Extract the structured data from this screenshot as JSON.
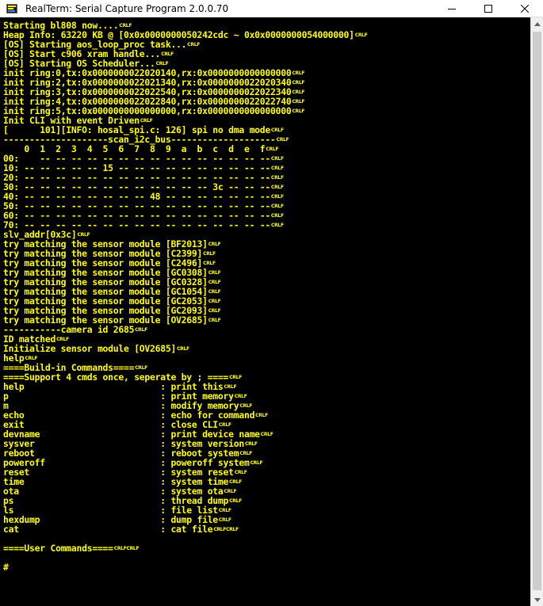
{
  "window": {
    "title": "RealTerm: Serial Capture Program 2.0.0.70"
  },
  "terminal": {
    "lines": [
      {
        "text": "Starting bl808 now....",
        "crlf": "CRLF"
      },
      {
        "text": "Heap Info: 63220 KB @ [0x0x0000000050242cdc ~ 0x0x0000000054000000]",
        "crlf": "CRLF"
      },
      {
        "text": "[OS] Starting aos_loop_proc task...",
        "crlf": "CRLF"
      },
      {
        "text": "[OS] Start c906 xram handle...",
        "crlf": "CRLF"
      },
      {
        "text": "[OS] Starting OS Scheduler...",
        "crlf": "CRLF"
      },
      {
        "text": "init ring:0,tx:0x0000000022020140,rx:0x0000000000000000",
        "crlf": "CRLF"
      },
      {
        "text": "init ring:2,tx:0x0000000022021340,rx:0x0000000022020340",
        "crlf": "CRLF"
      },
      {
        "text": "init ring:3,tx:0x0000000022022540,rx:0x0000000022022340",
        "crlf": "CRLF"
      },
      {
        "text": "init ring:4,tx:0x0000000022022840,rx:0x0000000022022740",
        "crlf": "CRLF"
      },
      {
        "text": "init ring:5,tx:0x0000000000000000,rx:0x0000000000000000",
        "crlf": "CRLF"
      },
      {
        "text": "Init CLI with event Driven",
        "crlf": "CRLF"
      },
      {
        "text": "[      101][INFO: hosal_spi.c: 126] spi no dma mode",
        "crlf": "CRLF"
      },
      {
        "text": "--------------------scan_i2c_bus--------------------",
        "crlf": "CRLF"
      },
      {
        "text": "    0  1  2  3  4  5  6  7  8  9  a  b  c  d  e  f",
        "crlf": "CRLF"
      },
      {
        "text": "00:    -- -- -- -- -- -- -- -- -- -- -- -- -- -- --",
        "crlf": "CRLF"
      },
      {
        "text": "10: -- -- -- -- -- 15 -- -- -- -- -- -- -- -- -- --",
        "crlf": "CRLF"
      },
      {
        "text": "20: -- -- -- -- -- -- -- -- -- -- -- -- -- -- -- --",
        "crlf": "CRLF"
      },
      {
        "text": "30: -- -- -- -- -- -- -- -- -- -- -- -- 3c -- -- --",
        "crlf": "CRLF"
      },
      {
        "text": "40: -- -- -- -- -- -- -- -- 48 -- -- -- -- -- -- --",
        "crlf": "CRLF"
      },
      {
        "text": "50: -- -- -- -- -- -- -- -- -- -- -- -- -- -- -- --",
        "crlf": "CRLF"
      },
      {
        "text": "60: -- -- -- -- -- -- -- -- -- -- -- -- -- -- -- --",
        "crlf": "CRLF"
      },
      {
        "text": "70: -- -- -- -- -- -- -- -- -- -- -- -- -- -- -- --",
        "crlf": "CRLF"
      },
      {
        "text": "slv_addr[0x3c]",
        "crlf": "CRLF"
      },
      {
        "text": "try matching the sensor module [BF2013]",
        "crlf": "CRLF"
      },
      {
        "text": "try matching the sensor module [C2399]",
        "crlf": "CRLF"
      },
      {
        "text": "try matching the sensor module [C2496]",
        "crlf": "CRLF"
      },
      {
        "text": "try matching the sensor module [GC0308]",
        "crlf": "CRLF"
      },
      {
        "text": "try matching the sensor module [GC0328]",
        "crlf": "CRLF"
      },
      {
        "text": "try matching the sensor module [GC1054]",
        "crlf": "CRLF"
      },
      {
        "text": "try matching the sensor module [GC2053]",
        "crlf": "CRLF"
      },
      {
        "text": "try matching the sensor module [GC2093]",
        "crlf": "CRLF"
      },
      {
        "text": "try matching the sensor module [OV2685]",
        "crlf": "CRLF"
      },
      {
        "text": "-----------camera id 2685",
        "crlf": "CRLF"
      },
      {
        "text": "ID matched",
        "crlf": "CRLF"
      },
      {
        "text": "Initialize sensor module [OV2685]",
        "crlf": "CRLF"
      },
      {
        "text": "help",
        "crlf": "CRLF"
      },
      {
        "text": "====Build-in Commands====",
        "crlf": "CRLF"
      },
      {
        "text": "====Support 4 cmds once, seperate by ; ====",
        "crlf": "CRLF"
      },
      {
        "text": "help                          : print this",
        "crlf": "CRLF"
      },
      {
        "text": "p                             : print memory",
        "crlf": "CRLF"
      },
      {
        "text": "m                             : modify memory",
        "crlf": "CRLF"
      },
      {
        "text": "echo                          : echo for command",
        "crlf": "CRLF"
      },
      {
        "text": "exit                          : close CLI",
        "crlf": "CRLF"
      },
      {
        "text": "devname                       : print device name",
        "crlf": "CRLF"
      },
      {
        "text": "sysver                        : system version",
        "crlf": "CRLF"
      },
      {
        "text": "reboot                        : reboot system",
        "crlf": "CRLF"
      },
      {
        "text": "poweroff                      : poweroff system",
        "crlf": "CRLF"
      },
      {
        "text": "reset                         : system reset",
        "crlf": "CRLF"
      },
      {
        "text": "time                          : system time",
        "crlf": "CRLF"
      },
      {
        "text": "ota                           : system ota",
        "crlf": "CRLF"
      },
      {
        "text": "ps                            : thread dump",
        "crlf": "CRLF"
      },
      {
        "text": "ls                            : file list",
        "crlf": "CRLF"
      },
      {
        "text": "hexdump                       : dump file",
        "crlf": "CRLF"
      },
      {
        "text": "cat                           : cat file",
        "crlf": "CRLFCRLF"
      },
      {
        "text": "",
        "crlf": ""
      },
      {
        "text": "====User Commands====",
        "crlf": "CRLFCRLF"
      },
      {
        "text": "",
        "crlf": ""
      },
      {
        "text": "#",
        "crlf": ""
      }
    ]
  },
  "icons": {
    "app": "realterm-app-icon",
    "minimize": "minimize-icon",
    "maximize": "maximize-icon",
    "close": "close-icon"
  },
  "colors": {
    "terminal_bg": "#000000",
    "terminal_fg": "#ffff00"
  }
}
